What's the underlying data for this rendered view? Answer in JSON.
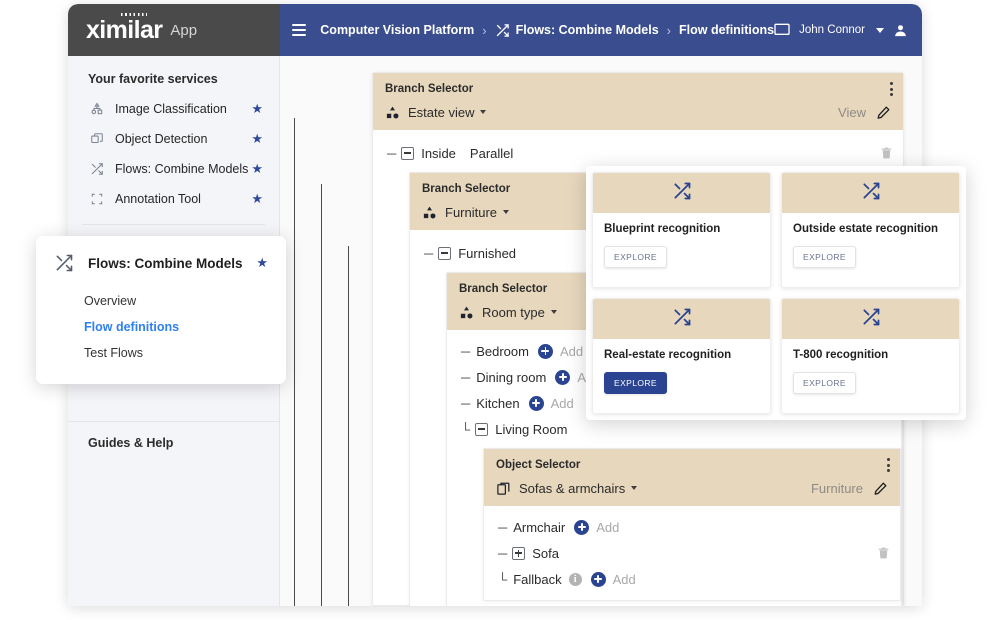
{
  "brand": {
    "logo_word": "ximilar",
    "logo_suffix": "App",
    "accent_blue": "#3a4e8f",
    "beige": "#e7d7bd",
    "deep_blue": "#2b4491",
    "link_blue": "#2f80f0"
  },
  "topbar": {
    "menu_icon": "hamburger-icon",
    "breadcrumbs": [
      {
        "label": "Computer Vision Platform",
        "icon": null
      },
      {
        "label": "Flows: Combine Models",
        "icon": "shuffle-icon"
      },
      {
        "label": "Flow definitions",
        "icon": null
      }
    ],
    "separator": "›",
    "monitor_icon": "monitor-icon",
    "user_name": "John Connor",
    "user_caret": "chevron-down-icon",
    "avatar_icon": "user-avatar-icon"
  },
  "sidebar": {
    "title": "Your favorite services",
    "items": [
      {
        "label": "Image Classification",
        "icon": "image-classification-icon",
        "starred": true
      },
      {
        "label": "Object Detection",
        "icon": "object-detection-icon",
        "starred": true
      },
      {
        "label": "Flows: Combine Models",
        "icon": "shuffle-icon",
        "starred": true
      },
      {
        "label": "Annotation Tool",
        "icon": "annotation-tool-icon",
        "starred": true
      }
    ],
    "star_glyph": "★",
    "footer": "Guides & Help"
  },
  "flyout": {
    "icon": "shuffle-icon",
    "title": "Flows: Combine Models",
    "star_glyph": "★",
    "links": [
      {
        "label": "Overview",
        "active": false
      },
      {
        "label": "Flow definitions",
        "active": true
      },
      {
        "label": "Test Flows",
        "active": false
      }
    ]
  },
  "flow": {
    "root": {
      "kind": "Branch Selector",
      "name": "Estate view",
      "icon": "branch-selector-icon",
      "tag": "View",
      "edit_icon": "pencil-icon",
      "menu_icon": "kebab-menu-icon",
      "caret": "caret-down-icon"
    },
    "inside": {
      "label": "Inside",
      "mode": "Parallel",
      "toggle": "collapse-toggle",
      "delete_icon": "trash-icon"
    },
    "furniture": {
      "kind": "Branch Selector",
      "name": "Furniture",
      "icon": "branch-selector-icon"
    },
    "furnished": {
      "label": "Furnished",
      "toggle": "collapse-toggle"
    },
    "room_type": {
      "kind": "Branch Selector",
      "name": "Room type",
      "icon": "branch-selector-icon"
    },
    "rooms": [
      {
        "label": "Bedroom",
        "add": "Add",
        "plus": "add-button"
      },
      {
        "label": "Dining room",
        "add": "Add",
        "plus": "add-button"
      },
      {
        "label": "Kitchen",
        "add": "Add",
        "plus": "add-button"
      }
    ],
    "living_room": {
      "label": "Living Room",
      "toggle": "collapse-toggle"
    },
    "object_selector": {
      "kind": "Object Selector",
      "name": "Sofas & armchairs",
      "icon": "object-selector-icon",
      "tag": "Furniture",
      "edit_icon": "pencil-icon",
      "menu_icon": "kebab-menu-icon",
      "children": [
        {
          "label": "Armchair",
          "add": "Add",
          "type": "add"
        },
        {
          "label": "Sofa",
          "type": "expand",
          "delete_icon": "trash-icon"
        },
        {
          "label": "Fallback",
          "add": "Add",
          "type": "add",
          "info": "i"
        }
      ]
    }
  },
  "card_panel": {
    "cards": [
      {
        "title": "Blueprint recognition",
        "button": "EXPLORE",
        "icon": "shuffle-icon",
        "primary": false
      },
      {
        "title": "Outside estate recognition",
        "button": "EXPLORE",
        "icon": "shuffle-icon",
        "primary": false
      },
      {
        "title": "Real-estate recognition",
        "button": "EXPLORE",
        "icon": "shuffle-icon",
        "primary": true
      },
      {
        "title": "T-800 recognition",
        "button": "EXPLORE",
        "icon": "shuffle-icon",
        "primary": false
      }
    ]
  }
}
